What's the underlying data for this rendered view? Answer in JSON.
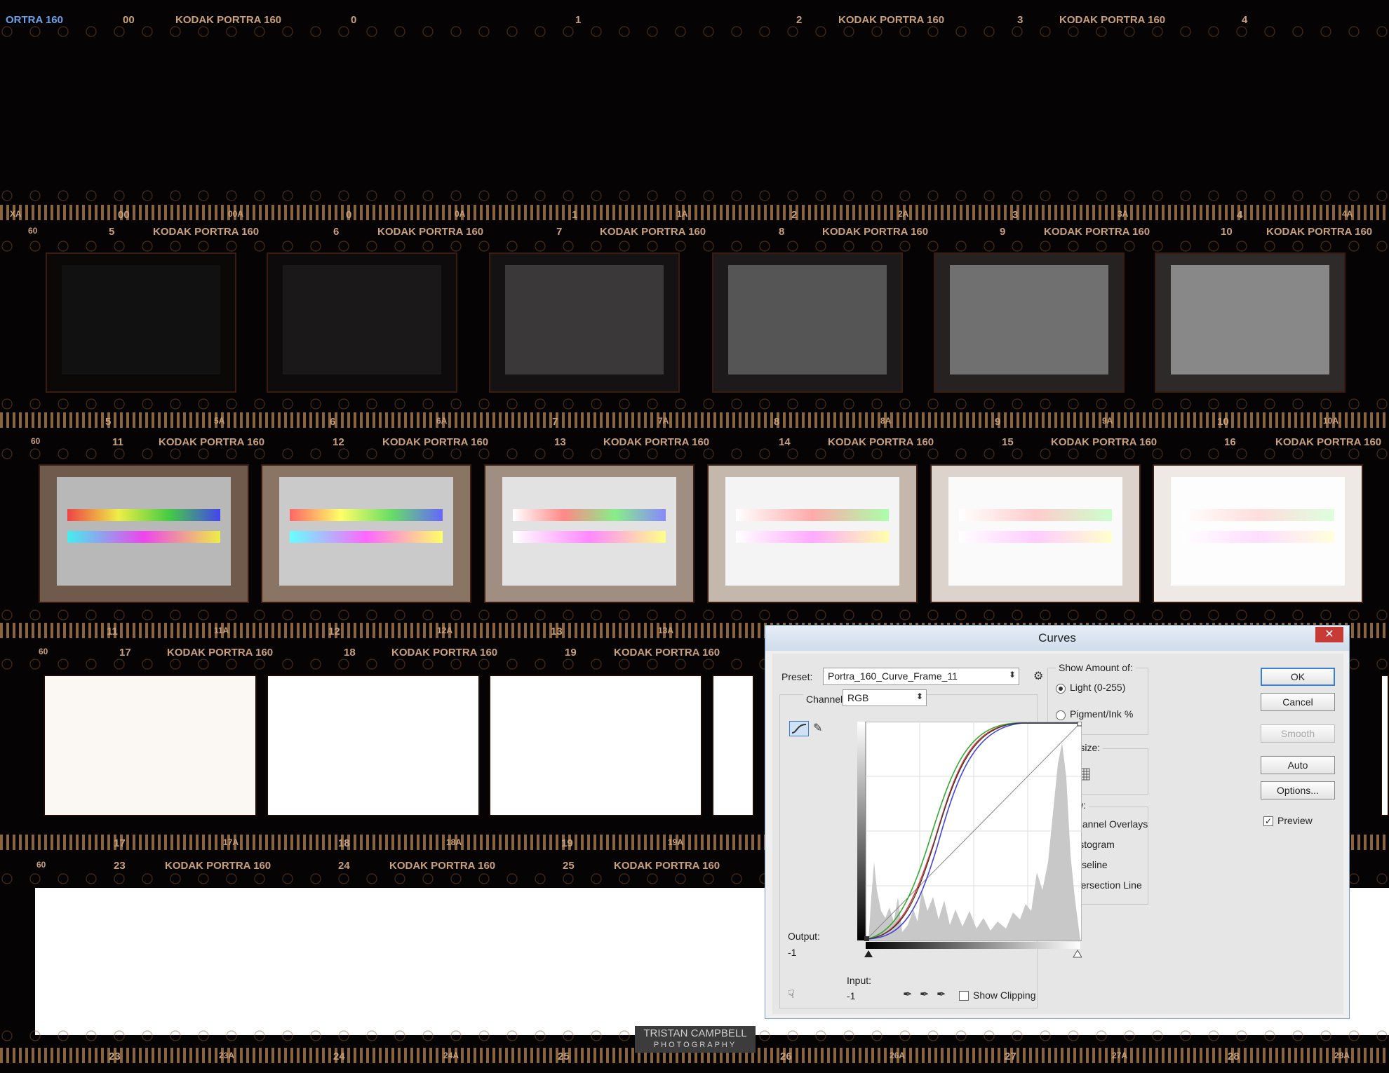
{
  "film": {
    "brand": "KODAK PORTRA 160",
    "top_row_numbers": [
      "00",
      "0",
      "1",
      "2",
      "3",
      "4"
    ],
    "strips": [
      {
        "frames": [
          "5",
          "6",
          "7",
          "8",
          "9",
          "10"
        ]
      },
      {
        "frames": [
          "11",
          "12",
          "13",
          "14",
          "15",
          "16"
        ]
      },
      {
        "frames": [
          "17",
          "18",
          "19"
        ]
      },
      {
        "frames": [
          "23",
          "24",
          "25"
        ]
      }
    ],
    "marks_row1": [
      "XA",
      "00",
      "00A",
      "0",
      "0A",
      "1",
      "1A",
      "2",
      "2A",
      "3",
      "3A",
      "4",
      "4A"
    ],
    "marks_row2": [
      "5",
      "5A",
      "6",
      "6A",
      "7",
      "7A",
      "8",
      "8A",
      "9",
      "9A",
      "10",
      "10A"
    ],
    "marks_row3": [
      "11",
      "11A",
      "12",
      "12A",
      "13",
      "13A"
    ],
    "marks_row4": [
      "17",
      "17A",
      "18",
      "18A",
      "19",
      "19A"
    ],
    "marks_row5": [
      "23",
      "23A",
      "24",
      "24A",
      "25",
      "26",
      "26A",
      "27",
      "27A",
      "28",
      "28A"
    ],
    "edge_code": "60"
  },
  "dialog": {
    "title": "Curves",
    "close_glyph": "✕",
    "preset_label": "Preset:",
    "preset_value": "Portra_160_Curve_Frame_11",
    "channel_label": "Channel:",
    "channel_value": "RGB",
    "output_label": "Output:",
    "output_value": "-1",
    "input_label": "Input:",
    "input_value": "-1",
    "show_clipping_label": "Show Clipping",
    "show_amount_label": "Show Amount of:",
    "light_label": "Light  (0-255)",
    "pigment_label": "Pigment/Ink %",
    "grid_size_label": "Grid size:",
    "show_label": "Show:",
    "options": [
      "Channel Overlays",
      "Histogram",
      "Baseline",
      "Intersection Line"
    ],
    "buttons": {
      "ok": "OK",
      "cancel": "Cancel",
      "smooth": "Smooth",
      "auto": "Auto",
      "options": "Options..."
    },
    "preview_label": "Preview",
    "check_glyph": "✓"
  },
  "watermark": {
    "line1": "TRISTAN CAMPBELL",
    "line2": "PHOTOGRAPHY"
  }
}
